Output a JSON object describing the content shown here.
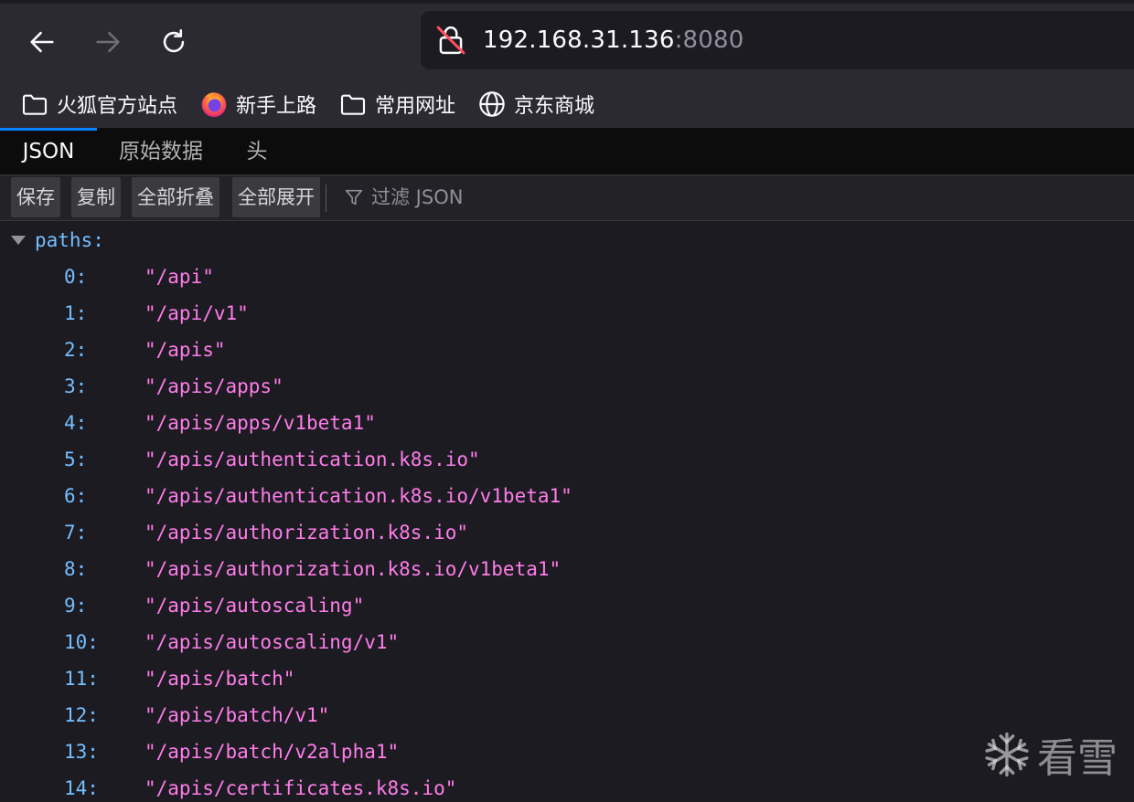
{
  "nav": {
    "back_icon": "arrow-left-icon",
    "forward_icon": "arrow-right-icon",
    "reload_icon": "reload-icon"
  },
  "urlbar": {
    "host": "192.168.31.136",
    "port": ":8080",
    "lock_icon": "insecure-lock-icon"
  },
  "bookmarks": [
    {
      "label": "火狐官方站点",
      "icon": "folder-icon"
    },
    {
      "label": "新手上路",
      "icon": "firefox-icon"
    },
    {
      "label": "常用网址",
      "icon": "folder-icon"
    },
    {
      "label": "京东商城",
      "icon": "globe-icon"
    }
  ],
  "viewer": {
    "tabs": [
      {
        "label": "JSON",
        "active": true
      },
      {
        "label": "原始数据",
        "active": false
      },
      {
        "label": "头",
        "active": false
      }
    ],
    "buttons": {
      "save": "保存",
      "copy": "复制",
      "collapse_all": "全部折叠",
      "expand_all": "全部展开"
    },
    "filter_placeholder": "过滤 JSON"
  },
  "json": {
    "root_key": "paths:",
    "items": [
      {
        "key": "0:",
        "value": "\"/api\""
      },
      {
        "key": "1:",
        "value": "\"/api/v1\""
      },
      {
        "key": "2:",
        "value": "\"/apis\""
      },
      {
        "key": "3:",
        "value": "\"/apis/apps\""
      },
      {
        "key": "4:",
        "value": "\"/apis/apps/v1beta1\""
      },
      {
        "key": "5:",
        "value": "\"/apis/authentication.k8s.io\""
      },
      {
        "key": "6:",
        "value": "\"/apis/authentication.k8s.io/v1beta1\""
      },
      {
        "key": "7:",
        "value": "\"/apis/authorization.k8s.io\""
      },
      {
        "key": "8:",
        "value": "\"/apis/authorization.k8s.io/v1beta1\""
      },
      {
        "key": "9:",
        "value": "\"/apis/autoscaling\""
      },
      {
        "key": "10:",
        "value": "\"/apis/autoscaling/v1\""
      },
      {
        "key": "11:",
        "value": "\"/apis/batch\""
      },
      {
        "key": "12:",
        "value": "\"/apis/batch/v1\""
      },
      {
        "key": "13:",
        "value": "\"/apis/batch/v2alpha1\""
      },
      {
        "key": "14:",
        "value": "\"/apis/certificates.k8s.io\""
      }
    ]
  },
  "watermark": {
    "text": "看雪",
    "icon": "snowflake-icon"
  },
  "colors": {
    "key": "#75bfff",
    "string": "#ff7de9",
    "accent": "#0a84ff"
  }
}
